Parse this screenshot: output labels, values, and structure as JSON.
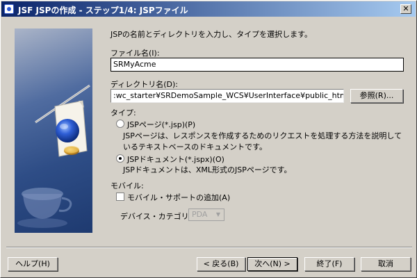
{
  "window": {
    "title": "JSF JSPの作成 - ステップ1/4: JSPファイル",
    "close_label": "✕"
  },
  "instruction": "JSPの名前とディレクトリを入力し、タイプを選択します。",
  "file_name": {
    "label": "ファイル名(I):",
    "value": "SRMyAcme"
  },
  "directory": {
    "label": "ディレクトリ名(D):",
    "value": ":wc_starter¥SRDemoSample_WCS¥UserInterface¥public_html¥app",
    "browse_label": "参照(R)..."
  },
  "type": {
    "label": "タイプ:",
    "options": [
      {
        "label": "JSPページ(*.jsp)(P)",
        "description": "JSPページは、レスポンスを作成するためのリクエストを処理する方法を説明しているテキストベースのドキュメントです。",
        "selected": false
      },
      {
        "label": "JSPドキュメント(*.jspx)(O)",
        "description": "JSPドキュメントは、XML形式のJSPページです。",
        "selected": true
      }
    ]
  },
  "mobile": {
    "label": "モバイル:",
    "add_support_label": "モバイル・サポートの追加(A)",
    "add_support_checked": false,
    "device_category_label": "デバイス・カテゴリ(D)",
    "device_category_value": "PDA"
  },
  "buttons": {
    "help": "ヘルプ(H)",
    "back": "< 戻る(B)",
    "next": "次へ(N) >",
    "finish": "終了(F)",
    "cancel": "取消"
  }
}
